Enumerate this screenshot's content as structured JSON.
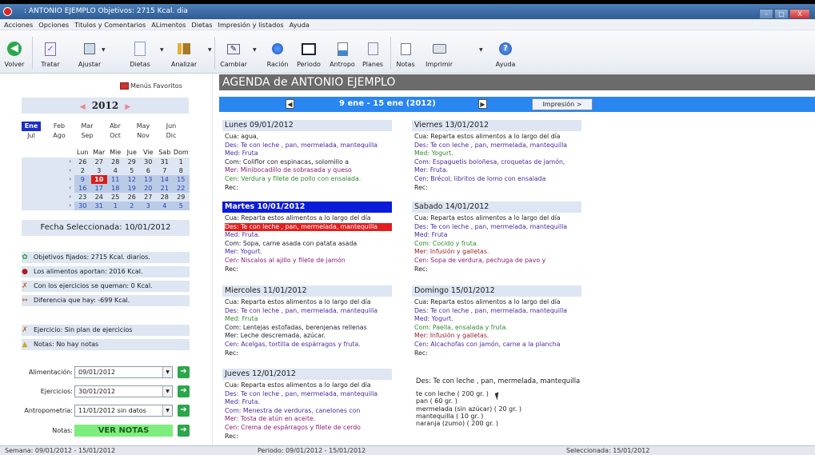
{
  "window": {
    "title": ": ANTONIO EJEMPLO Objetivos: 2715 Kcal. dia",
    "controls": [
      "–",
      "▢",
      "X"
    ]
  },
  "menu": [
    "Acciones",
    "Opciones",
    "Titulos y Comentarios",
    "ALimentos",
    "Dietas",
    "Impresión y listados",
    "Ayuda"
  ],
  "toolbar": [
    {
      "label": "Volver",
      "icon": "back-arrow-icon"
    },
    {
      "label": "Tratar",
      "icon": "checklist-icon"
    },
    {
      "label": "Ajustar",
      "icon": "adjust-icon"
    },
    {
      "label": "Dietas",
      "icon": "document-icon"
    },
    {
      "label": "Analizar",
      "icon": "analyze-icon"
    },
    {
      "label": "Cambiar",
      "icon": "edit-icon"
    },
    {
      "label": "Ración",
      "icon": "portion-icon"
    },
    {
      "label": "Periodo",
      "icon": "period-icon"
    },
    {
      "label": "Antropo",
      "icon": "anthropometry-icon"
    },
    {
      "label": "Planes",
      "icon": "plans-icon"
    },
    {
      "label": "Notas",
      "icon": "notes-icon"
    },
    {
      "label": "Imprimir",
      "icon": "printer-icon"
    },
    {
      "label": "Ayuda",
      "icon": "help-icon"
    }
  ],
  "left": {
    "favorites": "Menús Favoritos",
    "year": "2012",
    "months": [
      [
        "Ene",
        "Feb",
        "Mar",
        "Abr",
        "May",
        "Jun"
      ],
      [
        "Jul",
        "Ago",
        "Sep",
        "Oct",
        "Nov",
        "Dic"
      ]
    ],
    "selected_month": "Ene",
    "weekdays": [
      "Lun",
      "Mar",
      "Mie",
      "Jue",
      "Vie",
      "Sab",
      "Dom"
    ],
    "weeks": [
      [
        "26",
        "27",
        "28",
        "29",
        "30",
        "31",
        "1"
      ],
      [
        "2",
        "3",
        "4",
        "5",
        "6",
        "7",
        "8"
      ],
      [
        "9",
        "10",
        "11",
        "12",
        "13",
        "14",
        "15"
      ],
      [
        "16",
        "17",
        "18",
        "19",
        "20",
        "21",
        "22"
      ],
      [
        "23",
        "24",
        "25",
        "26",
        "27",
        "28",
        "29"
      ],
      [
        "30",
        "31",
        "1",
        "2",
        "3",
        "4",
        "5"
      ]
    ],
    "today": "10",
    "fecha_seleccionada": "Fecha Seleccionada: 10/01/2012",
    "info": [
      {
        "text": "Objetivos fijados: 2715 Kcal. diarios.",
        "icon": "target-icon"
      },
      {
        "text": "Los alimentos aportan: 2016 Kcal.",
        "icon": "food-icon"
      },
      {
        "text": "Con los ejercicios se queman: 0 Kcal.",
        "icon": "runner-icon"
      },
      {
        "text": "Diferencia que hay: -699 Kcal.",
        "icon": "difference-icon"
      }
    ],
    "info2": [
      {
        "text": "Ejercicio: Sin plan de ejercicios",
        "icon": "runner-icon"
      },
      {
        "text": "Notas: No hay notas",
        "icon": "notes-icon"
      }
    ],
    "form": [
      {
        "label": "Alimentación:",
        "value": "09/01/2012"
      },
      {
        "label": "Ejercicios:",
        "value": "30/01/2012"
      },
      {
        "label": "Antropometria:",
        "value": "11/01/2012 sin datos"
      }
    ],
    "notas_label": "Notas:",
    "ver_notas": "VER NOTAS"
  },
  "agenda": {
    "title": "AGENDA de ANTONIO EJEMPLO",
    "range": "9 ene - 15 ene (2012)",
    "impresion": "Impresión >",
    "days_left": [
      {
        "header": "Lunes 09/01/2012",
        "lines": [
          {
            "t": "Cua: agua,",
            "c": "c-cua"
          },
          {
            "t": "Des: Te con leche , pan, mermelada, mantequilla",
            "c": "c-des"
          },
          {
            "t": "Med: Fruta",
            "c": "c-med"
          },
          {
            "t": "Com: Coliflor con espinacas, solomillo a",
            "c": "c-com"
          },
          {
            "t": "Mer: Minibocadillo de sobrasada y queso",
            "c": "c-mer"
          },
          {
            "t": "Cen: Verdura y filete de pollo con ensalada.",
            "c": "c-cen"
          },
          {
            "t": "Rec:",
            "c": "c-rec"
          }
        ]
      },
      {
        "header": "Martes 10/01/2012",
        "selected": true,
        "lines": [
          {
            "t": "Cua: Reparta estos alimentos a lo largo del día",
            "c": "c-cua"
          },
          {
            "t": "Des: Te con leche , pan, mermelada, mantequilla",
            "c": "hl"
          },
          {
            "t": "Med: Fruta.",
            "c": "c-med"
          },
          {
            "t": "Com: Sopa, carne asada con patata asada",
            "c": "c-com"
          },
          {
            "t": "Mer: Yogurt.",
            "c": "c-des"
          },
          {
            "t": "Cen: Niscalos al ajillo y filete de jamón",
            "c": "c-mer"
          },
          {
            "t": "Rec:",
            "c": "c-rec"
          }
        ]
      },
      {
        "header": "Miercoles 11/01/2012",
        "lines": [
          {
            "t": "Cua: Reparta estos alimentos a lo largo del día",
            "c": "c-cua"
          },
          {
            "t": "Des: Te con leche , pan, mermelada, mantequilla",
            "c": "c-des"
          },
          {
            "t": "Med: Fruta",
            "c": "c-green"
          },
          {
            "t": "Com: Lentejas estofadas, berenjenas rellenas",
            "c": "c-com"
          },
          {
            "t": "Mer: Leche descremada, azúcar.",
            "c": "c-com"
          },
          {
            "t": "Cen: Acelgas, tortilla de espárragos y fruta.",
            "c": "c-des"
          },
          {
            "t": "Rec:",
            "c": "c-rec"
          }
        ]
      },
      {
        "header": "Jueves 12/01/2012",
        "lines": [
          {
            "t": "Cua: Reparta estos alimentos a lo largo del día",
            "c": "c-cua"
          },
          {
            "t": "Des: Te con leche , pan, mermelada, mantequilla",
            "c": "c-des"
          },
          {
            "t": "Med: Fruta.",
            "c": "c-med"
          },
          {
            "t": "Com: Menestra de verduras, canelones con",
            "c": "c-des"
          },
          {
            "t": "Mer: Tosta de atún en aceite.",
            "c": "c-mer"
          },
          {
            "t": "Cen: Crema de espárragos y filete de cerdo",
            "c": "c-mer"
          },
          {
            "t": "Rec:",
            "c": "c-rec"
          }
        ]
      }
    ],
    "days_right": [
      {
        "header": "Viernes 13/01/2012",
        "lines": [
          {
            "t": "Cua: Reparta estos alimentos a lo largo del día",
            "c": "c-cua"
          },
          {
            "t": "Des: Te con leche , pan, mermelada, mantequilla",
            "c": "c-des"
          },
          {
            "t": "Med: Yogurt.",
            "c": "c-green"
          },
          {
            "t": "Com: Espaguetis boloñesa, croquetas de jamón,",
            "c": "c-des"
          },
          {
            "t": "Mer: Fruta.",
            "c": "c-des"
          },
          {
            "t": "Cen: Brécol, libritos de lomo con ensalada",
            "c": "c-des"
          },
          {
            "t": "Rec:",
            "c": "c-rec"
          }
        ]
      },
      {
        "header": "Sabado 14/01/2012",
        "lines": [
          {
            "t": "Cua: Reparta estos alimentos a lo largo del día",
            "c": "c-cua"
          },
          {
            "t": "Des: Te con leche , pan, mermelada, mantequilla",
            "c": "c-des"
          },
          {
            "t": "Med: Fruta",
            "c": "c-des"
          },
          {
            "t": "Com: Cocido y fruta.",
            "c": "c-green"
          },
          {
            "t": "Mer: Infusión y galletas.",
            "c": "c-red"
          },
          {
            "t": "Cen: Sopa de verdura, pechuga de pavo y",
            "c": "c-mer"
          },
          {
            "t": "Rec:",
            "c": "c-rec"
          }
        ]
      },
      {
        "header": "Domingo 15/01/2012",
        "lines": [
          {
            "t": "Cua: Reparta estos alimentos a lo largo del día",
            "c": "c-cua"
          },
          {
            "t": "Des: Te con leche , pan, mermelada, mantequilla",
            "c": "c-des"
          },
          {
            "t": "Med: Yogurt.",
            "c": "c-des"
          },
          {
            "t": "Com: Paella, ensalada y fruta.",
            "c": "c-green"
          },
          {
            "t": "Mer: Infusión y galletas.",
            "c": "c-red"
          },
          {
            "t": "Cen: Alcachofas con jamón, carne a la plancha",
            "c": "c-des"
          },
          {
            "t": "Rec:",
            "c": "c-rec"
          }
        ]
      }
    ],
    "detail": {
      "title": "Des: Te con leche , pan, mermelada, mantequilla",
      "items": [
        "te con leche  ( 200 gr. )",
        "pan ( 60 gr. )",
        "mermelada (sin azúcar) ( 20 gr. )",
        "mantequilla ( 10 gr. )",
        "naranja (zumo) ( 200 gr. )"
      ]
    }
  },
  "status": {
    "semana": "Semana: 09/01/2012 - 15/01/2012",
    "periodo": "Periodo: 09/01/2012 - 15/01/2012",
    "seleccionada": "Seleccionada: 15/01/2012"
  }
}
